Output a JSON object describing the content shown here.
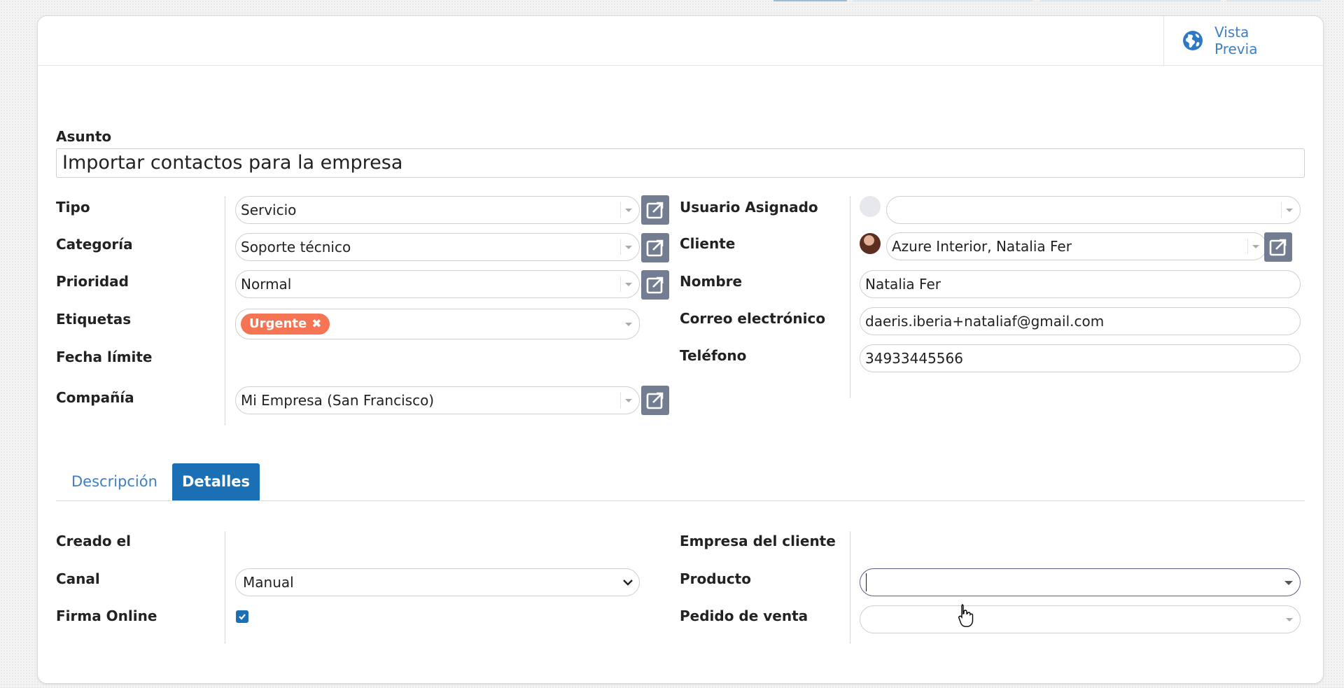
{
  "toolbar": {
    "preview_label_line1": "Vista",
    "preview_label_line2": "Previa",
    "preview_icon": "globe-icon"
  },
  "form": {
    "subject_label": "Asunto",
    "subject_value": "Importar contactos para la empresa",
    "left_fields": {
      "tipo_label": "Tipo",
      "tipo_value": "Servicio",
      "categoria_label": "Categoría",
      "categoria_value": "Soporte técnico",
      "prioridad_label": "Prioridad",
      "prioridad_value": "Normal",
      "etiquetas_label": "Etiquetas",
      "etiqueta_tag": "Urgente",
      "fecha_label": "Fecha límite",
      "compania_label": "Compañía",
      "compania_value": "Mi Empresa (San Francisco)"
    },
    "right_fields": {
      "usuario_label": "Usuario Asignado",
      "usuario_value": "",
      "cliente_label": "Cliente",
      "cliente_value": "Azure Interior, Natalia Fer",
      "nombre_label": "Nombre",
      "nombre_value": "Natalia Fer",
      "correo_label": "Correo electrónico",
      "correo_value": "daeris.iberia+nataliaf@gmail.com",
      "telefono_label": "Teléfono",
      "telefono_value": "34933445566"
    },
    "tabs": {
      "descripcion": "Descripción",
      "detalles": "Detalles",
      "active": "Detalles"
    },
    "details": {
      "creado_label": "Creado el",
      "canal_label": "Canal",
      "canal_value": "Manual",
      "firma_label": "Firma Online",
      "firma_checked": true,
      "empresa_cliente_label": "Empresa del cliente",
      "producto_label": "Producto",
      "producto_value": "",
      "pedido_label": "Pedido de venta",
      "pedido_value": ""
    }
  },
  "colors": {
    "accent": "#1a6fb5",
    "link": "#3f7fbf",
    "tag": "#f47453",
    "external_button": "#737d91"
  }
}
